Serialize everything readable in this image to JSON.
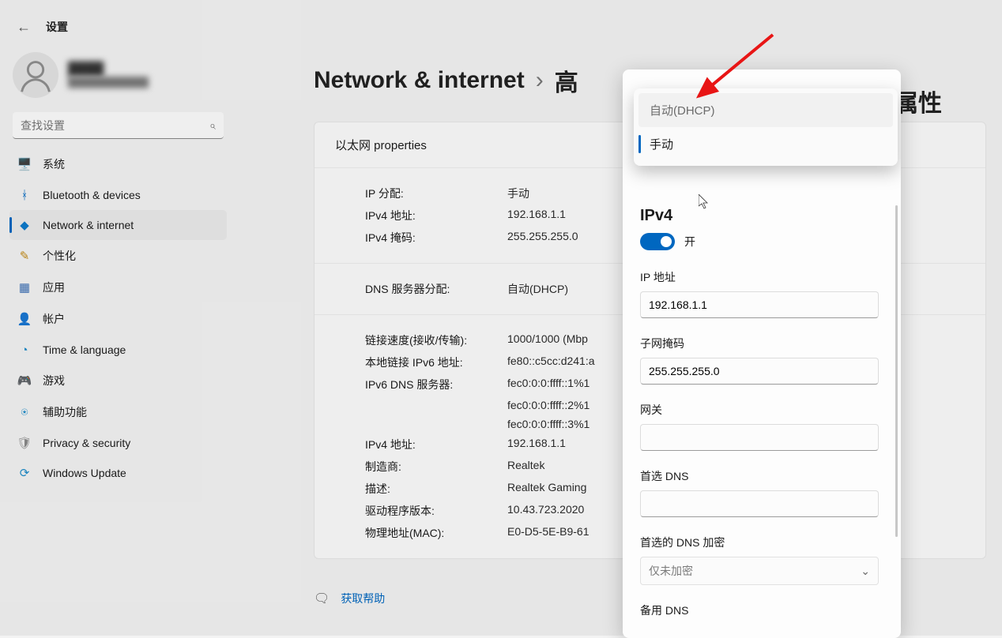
{
  "header": {
    "app_title": "设置"
  },
  "search": {
    "placeholder": "查找设置"
  },
  "sidebar": {
    "items": [
      {
        "label": "系统",
        "icon": "🖥️",
        "color": "#0067c0"
      },
      {
        "label": "Bluetooth & devices",
        "icon": "ᚼ",
        "color": "#0067c0"
      },
      {
        "label": "Network & internet",
        "icon": "◆",
        "color": "#0d7acb",
        "active": true
      },
      {
        "label": "个性化",
        "icon": "✎",
        "color": "#c28a16"
      },
      {
        "label": "应用",
        "icon": "▦",
        "color": "#3b6fb5"
      },
      {
        "label": "帐户",
        "icon": "👤",
        "color": "#2a9d5d"
      },
      {
        "label": "Time & language",
        "icon": "◔",
        "color": "#1e8cc9"
      },
      {
        "label": "游戏",
        "icon": "🎮",
        "color": "#5a7280"
      },
      {
        "label": "辅助功能",
        "icon": "⍟",
        "color": "#1e8cc9"
      },
      {
        "label": "Privacy & security",
        "icon": "🛡",
        "color": "#8a8a8a"
      },
      {
        "label": "Windows Update",
        "icon": "⟳",
        "color": "#1e8cc9"
      }
    ]
  },
  "breadcrumb": {
    "a": "Network & internet",
    "sep": "›",
    "b": "高",
    "tail": "属性"
  },
  "card": {
    "title": "以太网 properties"
  },
  "properties": {
    "sec1": [
      {
        "label": "IP 分配:",
        "value": "手动"
      },
      {
        "label": "IPv4 地址:",
        "value": "192.168.1.1"
      },
      {
        "label": "IPv4 掩码:",
        "value": "255.255.255.0"
      }
    ],
    "sec2": [
      {
        "label": "DNS 服务器分配:",
        "value": "自动(DHCP)"
      }
    ],
    "sec3": [
      {
        "label": "链接速度(接收/传输):",
        "value": "1000/1000 (Mbp"
      },
      {
        "label": "本地链接 IPv6 地址:",
        "value": "fe80::c5cc:d241:a"
      },
      {
        "label": "IPv6 DNS 服务器:",
        "value": "fec0:0:0:ffff::1%1\nfec0:0:0:ffff::2%1\nfec0:0:0:ffff::3%1"
      },
      {
        "label": "IPv4 地址:",
        "value": "192.168.1.1"
      },
      {
        "label": "制造商:",
        "value": "Realtek"
      },
      {
        "label": "描述:",
        "value": "Realtek Gaming"
      },
      {
        "label": "驱动程序版本:",
        "value": "10.43.723.2020"
      },
      {
        "label": "物理地址(MAC):",
        "value": "E0-D5-5E-B9-61"
      }
    ]
  },
  "help": {
    "label": "获取帮助"
  },
  "panel": {
    "dropdown": {
      "opt_auto": "自动(DHCP)",
      "opt_manual": "手动"
    },
    "ipv4_title": "IPv4",
    "toggle_label": "开",
    "ip_label": "IP 地址",
    "ip_value": "192.168.1.1",
    "subnet_label": "子网掩码",
    "subnet_value": "255.255.255.0",
    "gateway_label": "网关",
    "gateway_value": "",
    "dns_label": "首选 DNS",
    "dns_value": "",
    "dns_enc_label": "首选的 DNS 加密",
    "dns_enc_value": "仅未加密",
    "alt_dns_label": "备用 DNS"
  }
}
